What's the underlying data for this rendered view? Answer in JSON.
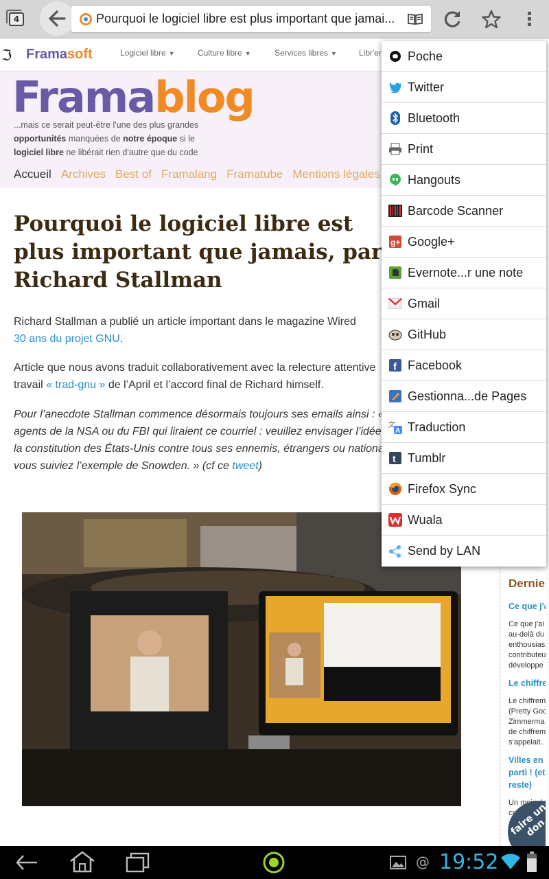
{
  "browser": {
    "tab_count": "4",
    "url_title": "Pourquoi le logiciel libre est plus important que jamai...",
    "icons": [
      "tabs-icon",
      "back-icon",
      "site-favicon-icon",
      "reader-mode-icon",
      "reload-icon",
      "bookmark-star-icon",
      "overflow-menu-icon"
    ]
  },
  "site_nav": {
    "brand_part1": "Frama",
    "brand_part2": "soft",
    "items": [
      {
        "label": "Logiciel libre"
      },
      {
        "label": "Culture libre"
      },
      {
        "label": "Services libres"
      },
      {
        "label": "Libr'en"
      }
    ]
  },
  "banner": {
    "title_part1": "Frama",
    "title_part2": "blog",
    "tagline_1": "...mais ce serait peut-être l'une des plus grandes",
    "tagline_2a": "opportunités",
    "tagline_2b": " manquées de ",
    "tagline_2c": "notre époque",
    "tagline_2d": " si le",
    "tagline_3a": "logiciel libre",
    "tagline_3b": " ne libérait rien d'autre que du code",
    "menu": [
      "Accueil",
      "Archives",
      "Best of",
      "Framalang",
      "Framatube",
      "Mentions légales"
    ]
  },
  "article": {
    "title": "Pourquoi le logiciel libre est plus important que jamais, par Richard Stallman",
    "p1_line1": "Richard Stallman a publié un article important dans le magazine Wired",
    "p1_link": "30 ans du projet GNU",
    "p1_end": ".",
    "p2_line1": "Article que nous avons traduit collaborativement avec la relecture attentive",
    "p2_start": "travail ",
    "p2_link": "« trad-gnu »",
    "p2_end": " de l’April et l’accord final de Richard himself.",
    "p3_line1": "Pour l’anecdote Stallman commence désormais toujours ses emails ainsi : «",
    "p3_line2": "agents de la NSA ou du FBI qui liraient ce courriel : veuillez envisager l’idée",
    "p3_line3": "la constitution des États-Unis contre tous ses ennemis, étrangers ou nationaux",
    "p3_line4_start": "vous suiviez l’exemple de Snowden. » (cf ce ",
    "p3_link": "tweet",
    "p3_end": ")"
  },
  "sidebar": {
    "heading": "Derniers",
    "posts": [
      {
        "title": "Ce que j'a",
        "lines": [
          "Ce que j'ai",
          "au-delà du",
          "enthousias",
          "contributeu",
          "développe"
        ]
      },
      {
        "title": "Le chiffre",
        "lines": [
          "Le chiffrem",
          "(Pretty Goo",
          "Zimmerma",
          "de chiffrem",
          "s’appelait.."
        ]
      },
      {
        "title": "Villes en l",
        "title2": "parti ! (et",
        "title3": "reste)",
        "lines": [
          "Un mois de",
          "créé"
        ]
      }
    ],
    "donate": "faire un don"
  },
  "share_menu": {
    "items": [
      {
        "label": "Poche",
        "icon": "poche-icon"
      },
      {
        "label": "Twitter",
        "icon": "twitter-icon"
      },
      {
        "label": "Bluetooth",
        "icon": "bluetooth-icon"
      },
      {
        "label": "Print",
        "icon": "print-icon"
      },
      {
        "label": "Hangouts",
        "icon": "hangouts-icon"
      },
      {
        "label": "Barcode Scanner",
        "icon": "barcode-scanner-icon"
      },
      {
        "label": "Google+",
        "icon": "google-plus-icon"
      },
      {
        "label": "Evernote...r une note",
        "icon": "evernote-icon"
      },
      {
        "label": "Gmail",
        "icon": "gmail-icon"
      },
      {
        "label": "GitHub",
        "icon": "github-icon"
      },
      {
        "label": "Facebook",
        "icon": "facebook-icon"
      },
      {
        "label": "Gestionna...de Pages",
        "icon": "page-manager-icon"
      },
      {
        "label": "Traduction",
        "icon": "translate-icon"
      },
      {
        "label": "Tumblr",
        "icon": "tumblr-icon"
      },
      {
        "label": "Firefox Sync",
        "icon": "firefox-icon"
      },
      {
        "label": "Wuala",
        "icon": "wuala-icon"
      },
      {
        "label": "Send by LAN",
        "icon": "share-icon"
      }
    ]
  },
  "system_bar": {
    "time": "19:52",
    "icons": [
      "nav-back-icon",
      "nav-home-icon",
      "nav-recents-icon",
      "app-indicator-icon",
      "gallery-icon",
      "at-icon",
      "wifi-icon",
      "battery-icon"
    ]
  },
  "colors": {
    "framasoft_violet": "#6a5aa6",
    "framasoft_orange": "#f08a24",
    "link_blue": "#2a8fc6",
    "clock_blue": "#33b5e5"
  }
}
